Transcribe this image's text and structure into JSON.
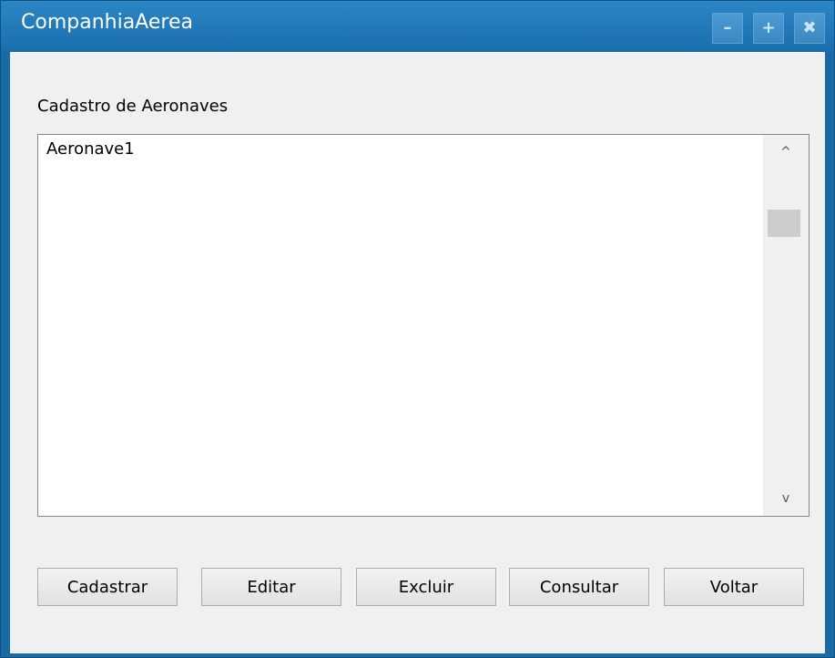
{
  "window": {
    "title": "CompanhiaAerea",
    "minimize_label": "–",
    "maximize_label": "+",
    "close_label": "✖"
  },
  "section": {
    "label": "Cadastro de Aeronaves"
  },
  "list": {
    "items": [
      "Aeronave1"
    ],
    "scroll_up_icon": "^",
    "scroll_down_icon": "v"
  },
  "buttons": {
    "cadastrar": "Cadastrar",
    "editar": "Editar",
    "excluir": "Excluir",
    "consultar": "Consultar",
    "voltar": "Voltar"
  },
  "colors": {
    "titlebar": "#1a6ead",
    "client_background": "#f0f0f0"
  }
}
